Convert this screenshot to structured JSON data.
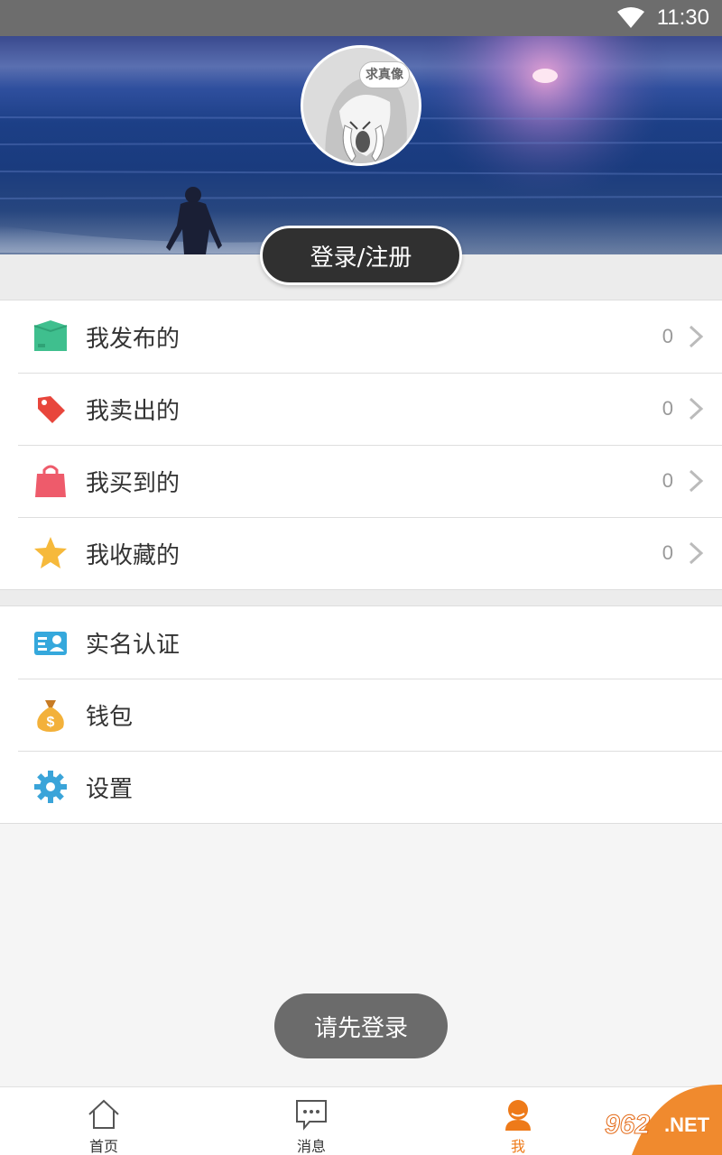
{
  "status_bar": {
    "time": "11:30",
    "wifi_icon": "wifi-icon"
  },
  "header": {
    "avatar_bubble": "求真像",
    "login_button": "登录/注册"
  },
  "list_main": [
    {
      "label": "我发布的",
      "count": "0",
      "icon": "box-icon",
      "color": "#3fbf8e"
    },
    {
      "label": "我卖出的",
      "count": "0",
      "icon": "tag-icon",
      "color": "#e8463c"
    },
    {
      "label": "我买到的",
      "count": "0",
      "icon": "shopping-bag-icon",
      "color": "#ee5b6b"
    },
    {
      "label": "我收藏的",
      "count": "0",
      "icon": "star-icon",
      "color": "#f6b93b"
    }
  ],
  "list_secondary": [
    {
      "label": "实名认证",
      "icon": "id-card-icon",
      "color": "#35a8dc"
    },
    {
      "label": "钱包",
      "icon": "money-bag-icon",
      "color": "#f3b13a"
    },
    {
      "label": "设置",
      "icon": "gear-icon",
      "color": "#3aa4d9"
    }
  ],
  "toast": "请先登录",
  "bottom_nav": [
    {
      "label": "首页",
      "icon": "home-icon"
    },
    {
      "label": "消息",
      "icon": "message-icon"
    },
    {
      "label": "我",
      "icon": "user-icon",
      "active": true
    }
  ],
  "colors": {
    "accent": "#ee7a19",
    "dark_button": "#303030"
  },
  "watermark": "962.NET"
}
